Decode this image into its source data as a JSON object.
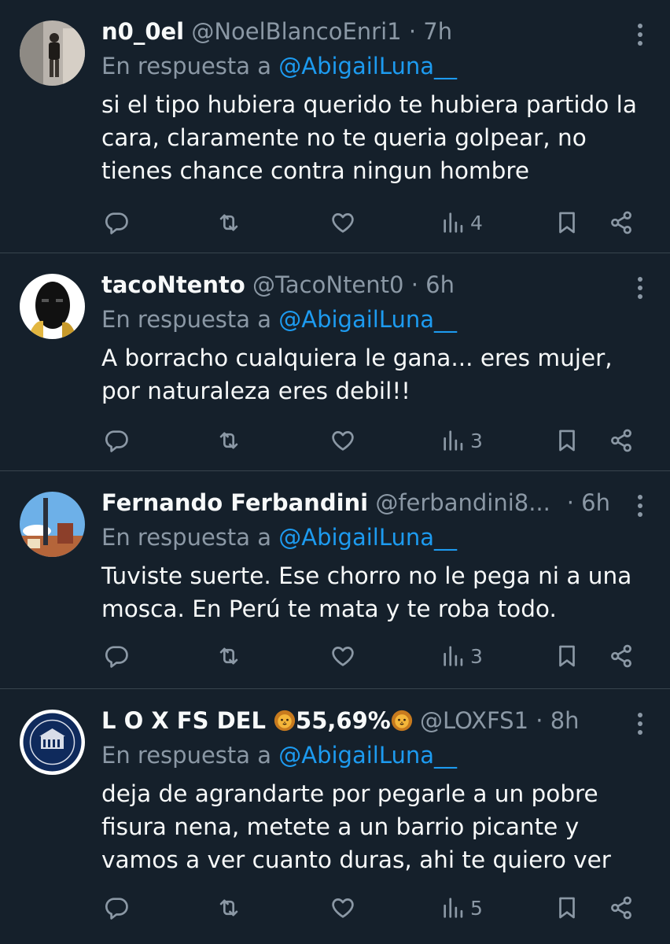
{
  "reply_prefix": "En respuesta a",
  "tweets": [
    {
      "name": "n0_0el",
      "handle": "@NoelBlancoEnri1",
      "sep": "·",
      "time": "7h",
      "mention": "@AbigailLuna__",
      "text": "si el tipo hubiera querido te hubiera partido la cara, claramente no te queria golpear, no tienes chance contra ningun hombre",
      "views": "4"
    },
    {
      "name": "tacoNtento",
      "handle": "@TacoNtent0",
      "sep": "·",
      "time": "6h",
      "mention": "@AbigailLuna__",
      "text": "A borracho cualquiera le gana... eres mujer, por naturaleza eres debil!!",
      "views": "3"
    },
    {
      "name": "Fernando Ferbandini",
      "handle": "@ferbandini8...",
      "sep": "·",
      "time": "6h",
      "mention": "@AbigailLuna__",
      "text": "Tuviste suerte. Ese chorro no le pega ni a una mosca. En Perú te mata y te roba todo.",
      "views": "3"
    },
    {
      "name_part1": "L O X FS DEL ",
      "name_part2": "55,69%",
      "handle": "@LOXFS1",
      "sep": "·",
      "time": "8h",
      "mention": "@AbigailLuna__",
      "text": "deja de agrandarte por pegarle a un pobre fisura nena, metete a un barrio picante y vamos a ver cuanto duras, ahi te quiero ver",
      "views": "5"
    }
  ],
  "icons": [
    "reply-icon",
    "retweet-icon",
    "like-icon",
    "views-icon",
    "bookmark-icon",
    "share-icon",
    "more-icon",
    "lion-emoji"
  ],
  "colors": {
    "background": "#15202b",
    "text": "#f7f9f9",
    "muted": "#8b98a5",
    "link": "#1d9bf0",
    "divider": "#38444d"
  }
}
